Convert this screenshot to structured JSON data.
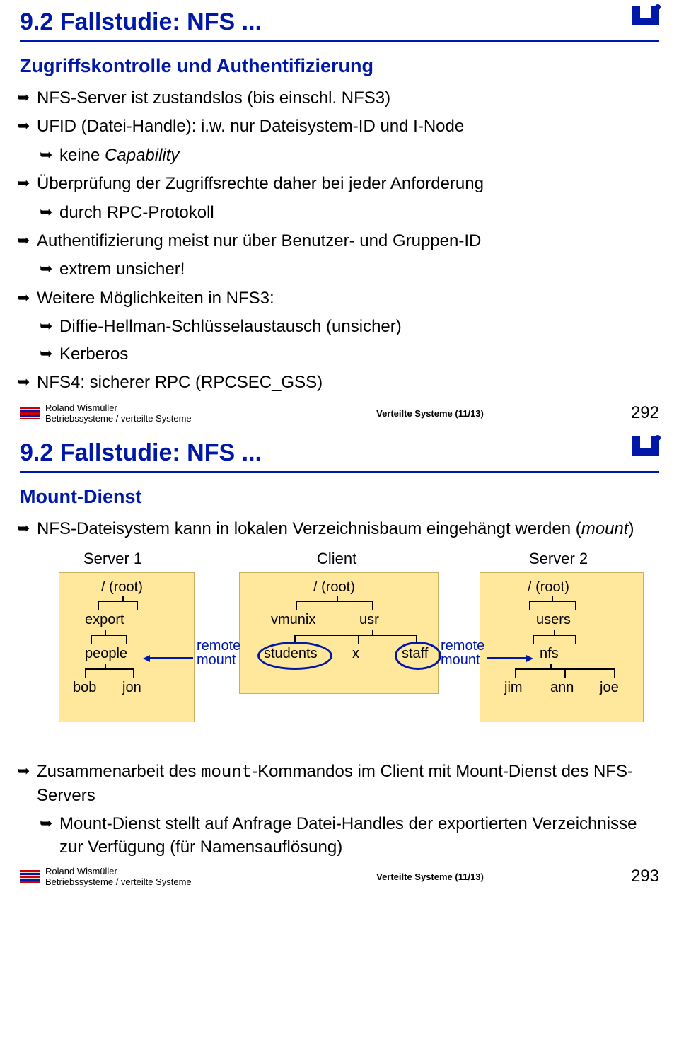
{
  "slide1": {
    "title": "9.2  Fallstudie: NFS ...",
    "subtitle": "Zugriffskontrolle und Authentifizierung",
    "b1": "NFS-Server ist zustandslos (bis einschl. NFS3)",
    "b2": "UFID (Datei-Handle): i.w. nur Dateisystem-ID und I-Node",
    "b2a": "keine ",
    "b2a_em": "Capability",
    "b3": "Überprüfung der Zugriffsrechte daher bei jeder Anforderung",
    "b3a": "durch RPC-Protokoll",
    "b4": "Authentifizierung meist nur über Benutzer- und Gruppen-ID",
    "b4a": "extrem unsicher!",
    "b5": "Weitere Möglichkeiten in NFS3:",
    "b5a": "Diffie-Hellman-Schlüsselaustausch (unsicher)",
    "b5b": "Kerberos",
    "b6": "NFS4: sicherer RPC (RPCSEC_GSS)"
  },
  "slide2": {
    "title": "9.2  Fallstudie: NFS ...",
    "subtitle": "Mount-Dienst",
    "b1a": "NFS-Dateisystem kann in lokalen Verzeichnisbaum eingehängt werden (",
    "b1a_em": "mount",
    "b1a_end": ")",
    "diagram": {
      "h1": "Server 1",
      "h2": "Client",
      "h3": "Server 2",
      "root": "/ (root)",
      "s1_l1": "export",
      "s1_l2": "people",
      "s1_l3a": "bob",
      "s1_l3b": "jon",
      "c_l1a": "vmunix",
      "c_l1b": "usr",
      "c_l2a": "students",
      "c_l2b": "x",
      "c_l2c": "staff",
      "s2_l1": "users",
      "s2_l2": "nfs",
      "s2_l3a": "jim",
      "s2_l3b": "ann",
      "s2_l3c": "joe",
      "rmount": "remote\nmount"
    },
    "b2a": "Zusammenarbeit des ",
    "b2b_tt": "mount",
    "b2c": "-Kommandos im Client mit Mount-Dienst des NFS-Servers",
    "b3": "Mount-Dienst stellt auf Anfrage Datei-Handles der exportierten Verzeichnisse zur Verfügung (für Namensauflösung)"
  },
  "footer": {
    "author": "Roland Wismüller",
    "dept": "Betriebssysteme / verteilte Systeme",
    "lecture": "Verteilte Systeme (11/13)",
    "page1": "292",
    "page2": "293"
  }
}
